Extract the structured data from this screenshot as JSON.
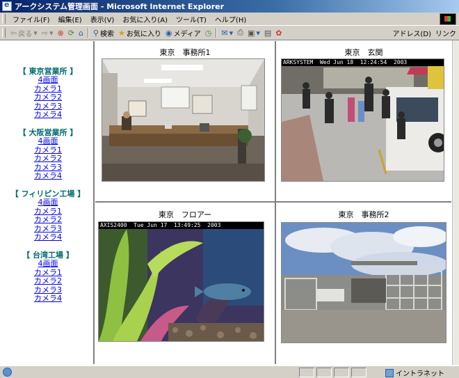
{
  "window": {
    "title": "アークシステム管理画面 - Microsoft Internet Explorer"
  },
  "menu": [
    "ファイル(F)",
    "編集(E)",
    "表示(V)",
    "お気に入り(A)",
    "ツール(T)",
    "ヘルプ(H)"
  ],
  "toolbar": {
    "back": "戻る",
    "search": "検索",
    "favorites": "お気に入り",
    "media": "メディア",
    "address": "アドレス(D)",
    "links": "リンク"
  },
  "nav": {
    "branches": [
      {
        "title": "【 東京営業所 】",
        "links": [
          "4画面",
          "カメラ1",
          "カメラ2",
          "カメラ3",
          "カメラ4"
        ]
      },
      {
        "title": "【 大阪営業所 】",
        "links": [
          "4画面",
          "カメラ1",
          "カメラ2",
          "カメラ3",
          "カメラ4"
        ]
      },
      {
        "title": "【 フィリピン工場 】",
        "links": [
          "4画面",
          "カメラ1",
          "カメラ2",
          "カメラ3",
          "カメラ4"
        ]
      },
      {
        "title": "【 台湾工場 】",
        "links": [
          "4画面",
          "カメラ1",
          "カメラ2",
          "カメラ3",
          "カメラ4"
        ]
      }
    ]
  },
  "cameras": [
    {
      "title": "東京　事務所1",
      "overlay": ""
    },
    {
      "title": "東京　玄関",
      "overlay": "ARKSYSTEM  Wed Jun 18  12:24:54  2003"
    },
    {
      "title": "東京　フロアー",
      "overlay": "AXIS2400  Tue Jun 17  13:49:25  2003"
    },
    {
      "title": "東京　事務所2",
      "overlay": ""
    }
  ],
  "status": {
    "zone": "イントラネット"
  },
  "colors": {
    "title_bar": "#0a246a",
    "branch_heading": "#006b6b",
    "link": "#0000ee"
  }
}
